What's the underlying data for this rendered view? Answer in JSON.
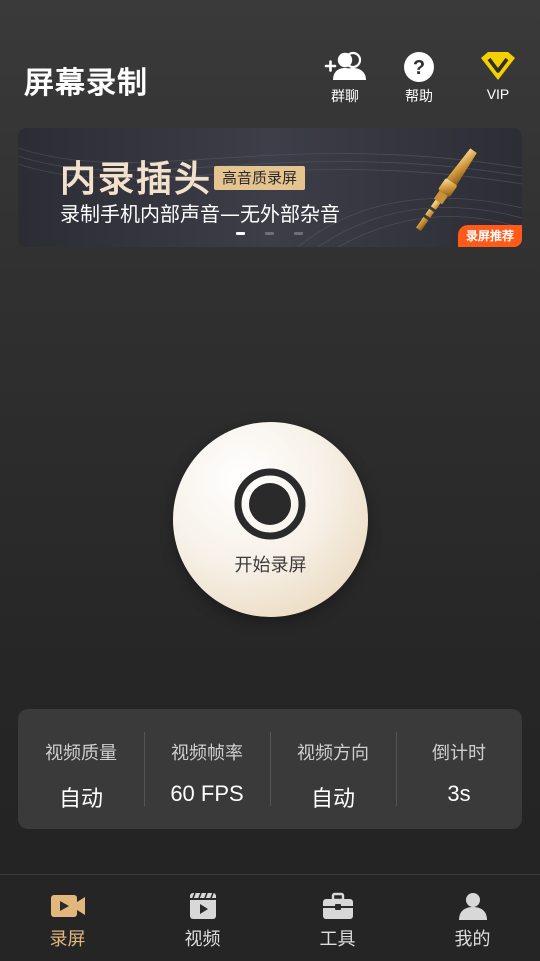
{
  "header": {
    "title": "屏幕录制",
    "group_chat_label": "群聊",
    "help_label": "帮助",
    "vip_label": "VIP"
  },
  "banner": {
    "title": "内录插头",
    "tag": "高音质录屏",
    "subtitle": "录制手机内部声音—无外部杂音",
    "badge": "录屏推荐",
    "slide_count": 3,
    "active_slide": 1
  },
  "record": {
    "label": "开始录屏"
  },
  "settings": [
    {
      "key": "视频质量",
      "value": "自动"
    },
    {
      "key": "视频帧率",
      "value": "60 FPS"
    },
    {
      "key": "视频方向",
      "value": "自动"
    },
    {
      "key": "倒计时",
      "value": "3s"
    }
  ],
  "tabs": [
    {
      "label": "录屏",
      "icon": "video-camera-icon",
      "active": true
    },
    {
      "label": "视频",
      "icon": "video-file-icon",
      "active": false
    },
    {
      "label": "工具",
      "icon": "toolbox-icon",
      "active": false
    },
    {
      "label": "我的",
      "icon": "user-icon",
      "active": false
    }
  ],
  "colors": {
    "accent_gold": "#e2b77c",
    "vip_yellow": "#f5d000",
    "badge_orange": "#ff5a1a"
  }
}
